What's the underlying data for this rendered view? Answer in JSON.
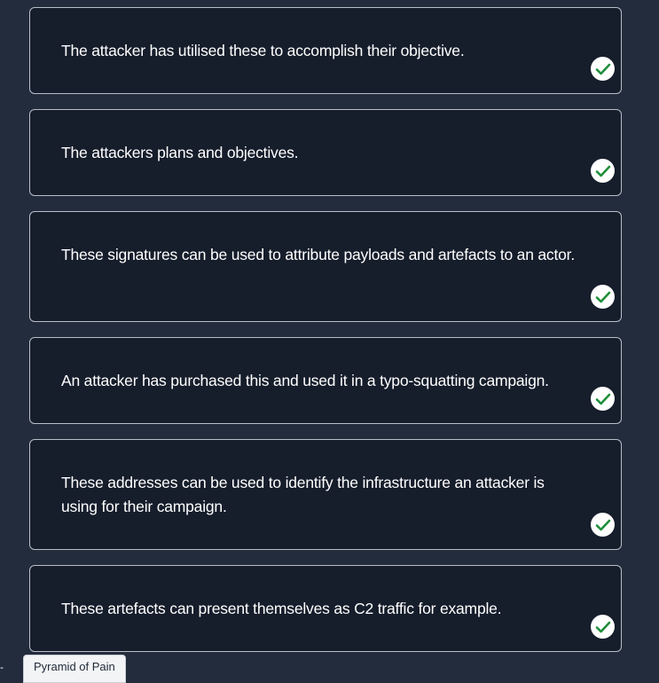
{
  "cards": [
    {
      "text": "The attacker has utilised these to accomplish their objective.",
      "status": "correct"
    },
    {
      "text": "The attackers plans and objectives.",
      "status": "correct"
    },
    {
      "text": "These signatures can be used to attribute payloads and artefacts to an actor.",
      "status": "correct"
    },
    {
      "text": "An attacker has purchased this and used it in a typo-squatting campaign.",
      "status": "correct"
    },
    {
      "text": "These addresses can be used to identify the infrastructure an attacker is using for their campaign.",
      "status": "correct"
    },
    {
      "text": "These artefacts can present themselves as C2 traffic for example.",
      "status": "correct"
    }
  ],
  "bottom_tab": {
    "label": "Pyramid of Pain",
    "left_marker": "-"
  },
  "colors": {
    "page_bg": "#222c3d",
    "card_bg": "#161d2b",
    "card_border": "#b9bfc8",
    "text": "#ffffff",
    "check_color": "#1f8f3a"
  },
  "icons": {
    "status": "check-circle-icon"
  }
}
